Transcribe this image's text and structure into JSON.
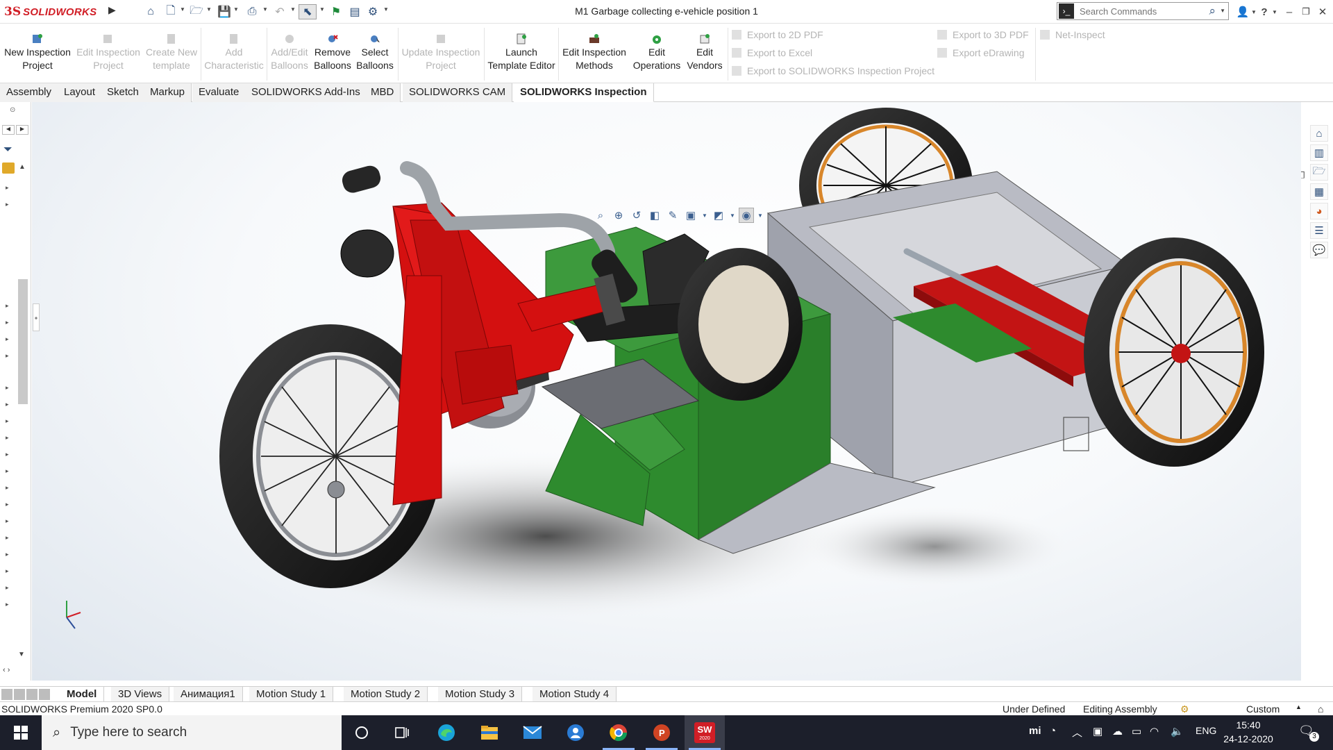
{
  "app": {
    "brand_ds": "3S",
    "brand_name": "SOLIDWORKS",
    "document_title": "M1 Garbage collecting e-vehicle position 1"
  },
  "search": {
    "placeholder": "Search Commands"
  },
  "ribbon": {
    "new_inspection_l1": "New Inspection",
    "new_inspection_l2": "Project",
    "edit_inspection_l1": "Edit Inspection",
    "edit_inspection_l2": "Project",
    "create_template_l1": "Create New",
    "create_template_l2": "template",
    "add_char_l1": "Add",
    "add_char_l2": "Characteristic",
    "add_edit_balloons_l1": "Add/Edit",
    "add_edit_balloons_l2": "Balloons",
    "remove_balloons_l1": "Remove",
    "remove_balloons_l2": "Balloons",
    "select_balloons_l1": "Select",
    "select_balloons_l2": "Balloons",
    "update_inspection_l1": "Update Inspection",
    "update_inspection_l2": "Project",
    "launch_template_l1": "Launch",
    "launch_template_l2": "Template Editor",
    "edit_methods_l1": "Edit Inspection",
    "edit_methods_l2": "Methods",
    "edit_operations_l1": "Edit",
    "edit_operations_l2": "Operations",
    "edit_vendors_l1": "Edit",
    "edit_vendors_l2": "Vendors",
    "export_2d_pdf": "Export to 2D PDF",
    "export_excel": "Export to Excel",
    "export_sw_inspection": "Export to SOLIDWORKS Inspection Project",
    "export_3d_pdf": "Export to 3D PDF",
    "export_edrawing": "Export eDrawing",
    "net_inspect": "Net-Inspect"
  },
  "tabs": [
    "Assembly",
    "Layout",
    "Sketch",
    "Markup",
    "Evaluate",
    "SOLIDWORKS Add-Ins",
    "MBD",
    "SOLIDWORKS CAM",
    "SOLIDWORKS Inspection"
  ],
  "bottom_tabs": [
    "Model",
    "3D Views",
    "Анимация1",
    "Motion Study 1",
    "Motion Study 2",
    "Motion Study 3",
    "Motion Study 4"
  ],
  "status": {
    "product": "SOLIDWORKS Premium 2020 SP0.0",
    "state": "Under Defined",
    "mode": "Editing Assembly",
    "units": "Custom"
  },
  "taskbar": {
    "search_placeholder": "Type here to search",
    "lang": "ENG",
    "time": "15:40",
    "date": "24-12-2020",
    "notif_count": "3",
    "sw_badge": "SW",
    "sw_year": "2020"
  },
  "colors": {
    "brand_red": "#d11e26",
    "frame_red": "#d41010",
    "body_green": "#2e8b2e",
    "chassis_gray": "#c9cbd2",
    "taskbar_bg": "#1c1f2b"
  },
  "icons": [
    "home-icon",
    "new-doc-icon",
    "open-icon",
    "save-icon",
    "print-icon",
    "undo-icon",
    "select-icon",
    "rebuild-icon",
    "file-props-icon",
    "options-icon",
    "user-icon",
    "help-icon"
  ]
}
